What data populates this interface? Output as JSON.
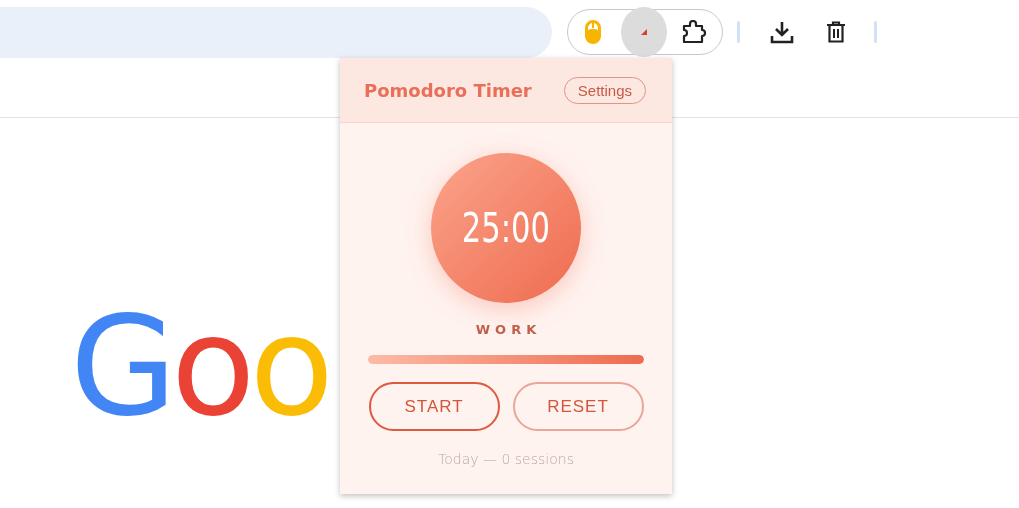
{
  "toolbar": {
    "extensions": [
      {
        "kind": "mouse",
        "active": false
      },
      {
        "kind": "timer",
        "active": true
      },
      {
        "kind": "puzzle",
        "active": false
      }
    ],
    "actions": [
      {
        "kind": "download"
      },
      {
        "kind": "trash"
      }
    ]
  },
  "page": {
    "logo": "Goo"
  },
  "popup": {
    "title": "Pomodoro Timer",
    "settings_button": "Settings",
    "timer": {
      "time": "25:00",
      "mode": "WORK",
      "level": 1
    },
    "buttons": [
      {
        "label": "START",
        "kind": "primary"
      },
      {
        "label": "RESET",
        "kind": "secondary"
      }
    ],
    "footer": "Today — 0 sessions"
  }
}
